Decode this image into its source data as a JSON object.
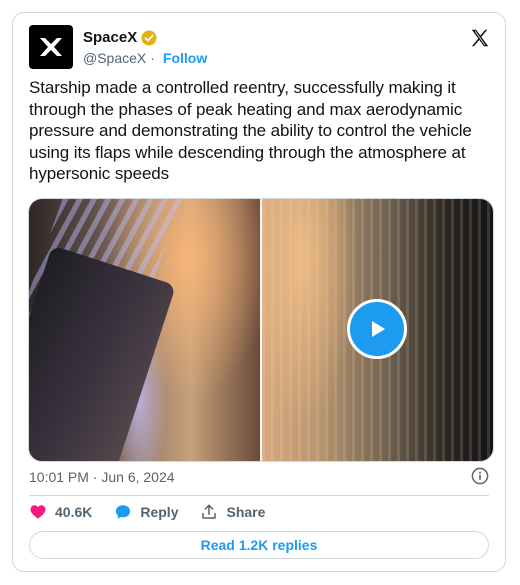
{
  "author": {
    "name": "SpaceX",
    "handle": "@SpaceX",
    "separator": "·",
    "follow_label": "Follow",
    "verified_color": "#e8b00f"
  },
  "tweet": {
    "text": "Starship made a controlled reentry, successfully making it through the phases of peak heating and max aerodynamic pressure and demonstrating the ability to control the vehicle using its flaps while descending through the atmosphere at hypersonic speeds",
    "timestamp": "10:01 PM · Jun 6, 2024"
  },
  "actions": {
    "likes": "40.6K",
    "reply_label": "Reply",
    "share_label": "Share",
    "read_replies_label": "Read 1.2K replies"
  },
  "colors": {
    "accent": "#1d9bf0",
    "like": "#f91880",
    "muted": "#536471",
    "border": "#cfd9de"
  },
  "icons": [
    "spacex-logo-icon",
    "verified-badge-icon",
    "x-logo-icon",
    "play-icon",
    "info-icon",
    "heart-icon",
    "reply-bubble-icon",
    "share-icon"
  ]
}
